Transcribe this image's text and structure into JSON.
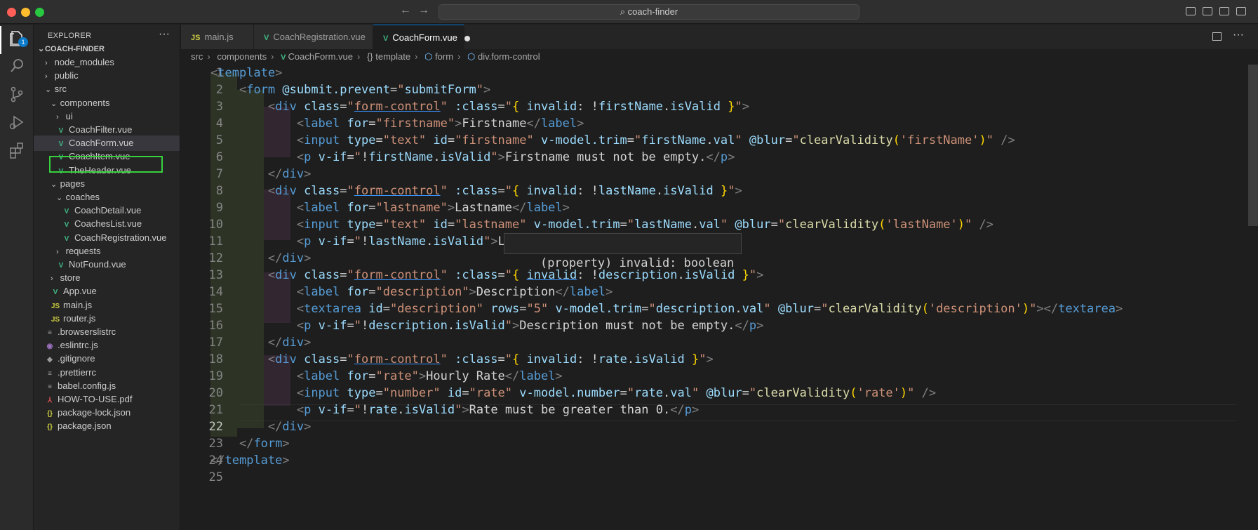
{
  "window": {
    "search_text": "coach-finder"
  },
  "sidebar": {
    "title": "EXPLORER",
    "more": "···",
    "root": "COACH-FINDER",
    "items": [
      {
        "label": "node_modules",
        "kind": "folder",
        "chev": "›"
      },
      {
        "label": "public",
        "kind": "folder",
        "chev": "›"
      },
      {
        "label": "src",
        "kind": "folder",
        "chev": "⌄"
      },
      {
        "label": "components",
        "kind": "folder",
        "chev": "⌄"
      },
      {
        "label": "ui",
        "kind": "folder",
        "chev": "›"
      },
      {
        "label": "CoachFilter.vue",
        "kind": "vue"
      },
      {
        "label": "CoachForm.vue",
        "kind": "vue"
      },
      {
        "label": "CoachItem.vue",
        "kind": "vue"
      },
      {
        "label": "TheHeader.vue",
        "kind": "vue"
      },
      {
        "label": "pages",
        "kind": "folder",
        "chev": "⌄"
      },
      {
        "label": "coaches",
        "kind": "folder",
        "chev": "⌄"
      },
      {
        "label": "CoachDetail.vue",
        "kind": "vue"
      },
      {
        "label": "CoachesList.vue",
        "kind": "vue"
      },
      {
        "label": "CoachRegistration.vue",
        "kind": "vue"
      },
      {
        "label": "requests",
        "kind": "folder",
        "chev": "›"
      },
      {
        "label": "NotFound.vue",
        "kind": "vue"
      },
      {
        "label": "store",
        "kind": "folder",
        "chev": "›"
      },
      {
        "label": "App.vue",
        "kind": "vue"
      },
      {
        "label": "main.js",
        "kind": "js"
      },
      {
        "label": "router.js",
        "kind": "js"
      },
      {
        "label": ".browserslistrc",
        "kind": "text"
      },
      {
        "label": ".eslintrc.js",
        "kind": "eslint"
      },
      {
        "label": ".gitignore",
        "kind": "git"
      },
      {
        "label": ".prettierrc",
        "kind": "text"
      },
      {
        "label": "babel.config.js",
        "kind": "text"
      },
      {
        "label": "HOW-TO-USE.pdf",
        "kind": "pdf"
      },
      {
        "label": "package-lock.json",
        "kind": "json"
      },
      {
        "label": "package.json",
        "kind": "json"
      }
    ],
    "badge_count": "1"
  },
  "tabs": [
    {
      "label": "main.js",
      "icon": "JS"
    },
    {
      "label": "CoachRegistration.vue",
      "icon": "V"
    },
    {
      "label": "CoachForm.vue",
      "icon": "V",
      "active": true,
      "modified": true
    }
  ],
  "breadcrumb": [
    "src",
    "components",
    "CoachForm.vue",
    "{} template",
    "form",
    "div.form-control"
  ],
  "editor": {
    "current_line": 22,
    "line_numbers": [
      "1",
      "2",
      "3",
      "4",
      "5",
      "6",
      "7",
      "8",
      "9",
      "10",
      "11",
      "12",
      "13",
      "14",
      "15",
      "16",
      "17",
      "18",
      "19",
      "20",
      "21",
      "22",
      "23",
      "24",
      "25"
    ],
    "hover_text": "(property) invalid: boolean"
  }
}
